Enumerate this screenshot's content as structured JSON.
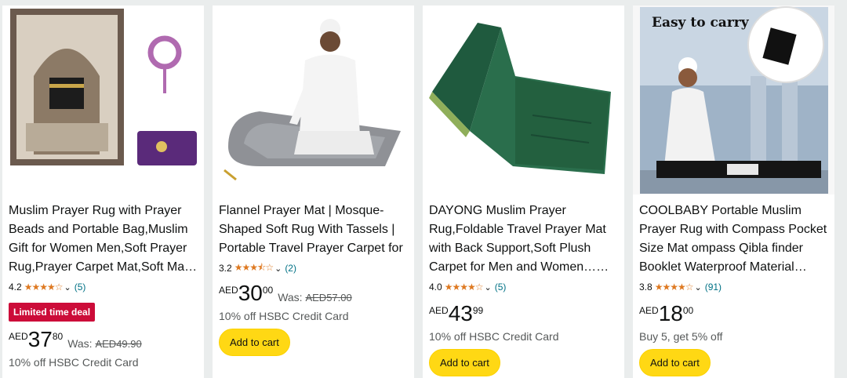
{
  "products": [
    {
      "title": "Muslim Prayer Rug with Prayer Beads and Portable Bag,Muslim Gift for Women Men,Soft Prayer Rug,Prayer Carpet Mat,Soft Ma…",
      "rating": "4.2",
      "stars": "★★★★☆",
      "review_count": "(5)",
      "deal_badge": "Limited time deal",
      "currency": "AED",
      "price_whole": "37",
      "price_fraction": "80",
      "was_label": "Was:",
      "was_price": "AED49.90",
      "note": "10% off HSBC Credit Card"
    },
    {
      "title": "Flannel Prayer Mat | Mosque-Shaped Soft Rug With Tassels | Portable Travel Prayer Carpet for",
      "rating": "3.2",
      "stars": "★★★⯪☆",
      "review_count": "(2)",
      "currency": "AED",
      "price_whole": "30",
      "price_fraction": "00",
      "was_label": "Was:",
      "was_price": "AED57.00",
      "note": "10% off HSBC Credit Card",
      "button": "Add to cart"
    },
    {
      "title": "DAYONG Muslim Prayer Rug,Foldable Travel Prayer Mat with Back Support,Soft Plush Carpet for Men and Women……",
      "rating": "4.0",
      "stars": "★★★★☆",
      "review_count": "(5)",
      "currency": "AED",
      "price_whole": "43",
      "price_fraction": "99",
      "note": "10% off HSBC Credit Card",
      "button": "Add to cart"
    },
    {
      "title": "COOLBABY Portable Muslim Prayer Rug with Compass Pocket Size Mat ompass Qibla finder Booklet Waterproof Material…",
      "rating": "3.8",
      "stars": "★★★★☆",
      "review_count": "(91)",
      "currency": "AED",
      "price_whole": "18",
      "price_fraction": "00",
      "note": "Buy 5, get 5% off",
      "button": "Add to cart",
      "image_caption": "Easy to carry"
    }
  ],
  "chevron": "❯"
}
